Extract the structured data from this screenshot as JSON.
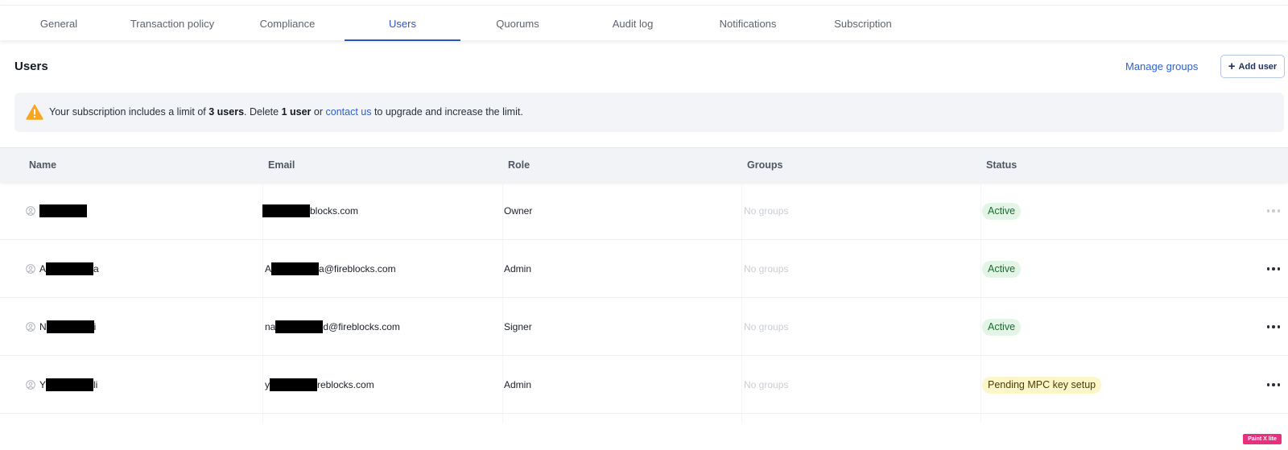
{
  "tabs": [
    {
      "label": "General",
      "active": false
    },
    {
      "label": "Transaction policy",
      "active": false
    },
    {
      "label": "Compliance",
      "active": false
    },
    {
      "label": "Users",
      "active": true
    },
    {
      "label": "Quorums",
      "active": false
    },
    {
      "label": "Audit log",
      "active": false
    },
    {
      "label": "Notifications",
      "active": false
    },
    {
      "label": "Subscription",
      "active": false
    }
  ],
  "header": {
    "title": "Users",
    "manage_groups_label": "Manage groups",
    "add_user_label": "Add user",
    "add_user_icon": "plus-icon"
  },
  "banner": {
    "icon": "warning-icon",
    "text_1": "Your subscription includes a limit of ",
    "limit": "3 users",
    "text_2": ". Delete ",
    "delete_count": "1 user",
    "text_3": " or ",
    "link": "contact us",
    "text_4": " to upgrade and increase the limit."
  },
  "table": {
    "columns": [
      "Name",
      "Email",
      "Role",
      "Groups",
      "Status"
    ],
    "rows": [
      {
        "name_prefix": "",
        "name_suffix": "",
        "email_prefix": "",
        "email_suffix": "blocks.com",
        "role": "Owner",
        "groups": "No groups",
        "status": "Active",
        "status_type": "active"
      },
      {
        "name_prefix": "A",
        "name_suffix": "a",
        "email_prefix": "A",
        "email_suffix": "a@fireblocks.com",
        "role": "Admin",
        "groups": "No groups",
        "status": "Active",
        "status_type": "active"
      },
      {
        "name_prefix": "N",
        "name_suffix": "i",
        "email_prefix": "na",
        "email_suffix": "d@fireblocks.com",
        "role": "Signer",
        "groups": "No groups",
        "status": "Active",
        "status_type": "active"
      },
      {
        "name_prefix": "Y",
        "name_suffix": "li",
        "email_prefix": "y",
        "email_suffix": "reblocks.com",
        "role": "Admin",
        "groups": "No groups",
        "status": "Pending MPC key setup",
        "status_type": "pending"
      }
    ]
  },
  "watermark": "Paint X lite",
  "colors": {
    "accent": "#2c54c5",
    "link": "#2f62c9",
    "active_bg": "#e3f5e6",
    "active_text": "#1b6a2c",
    "pending_bg": "#fdf6c8",
    "warning": "#f5a623"
  }
}
